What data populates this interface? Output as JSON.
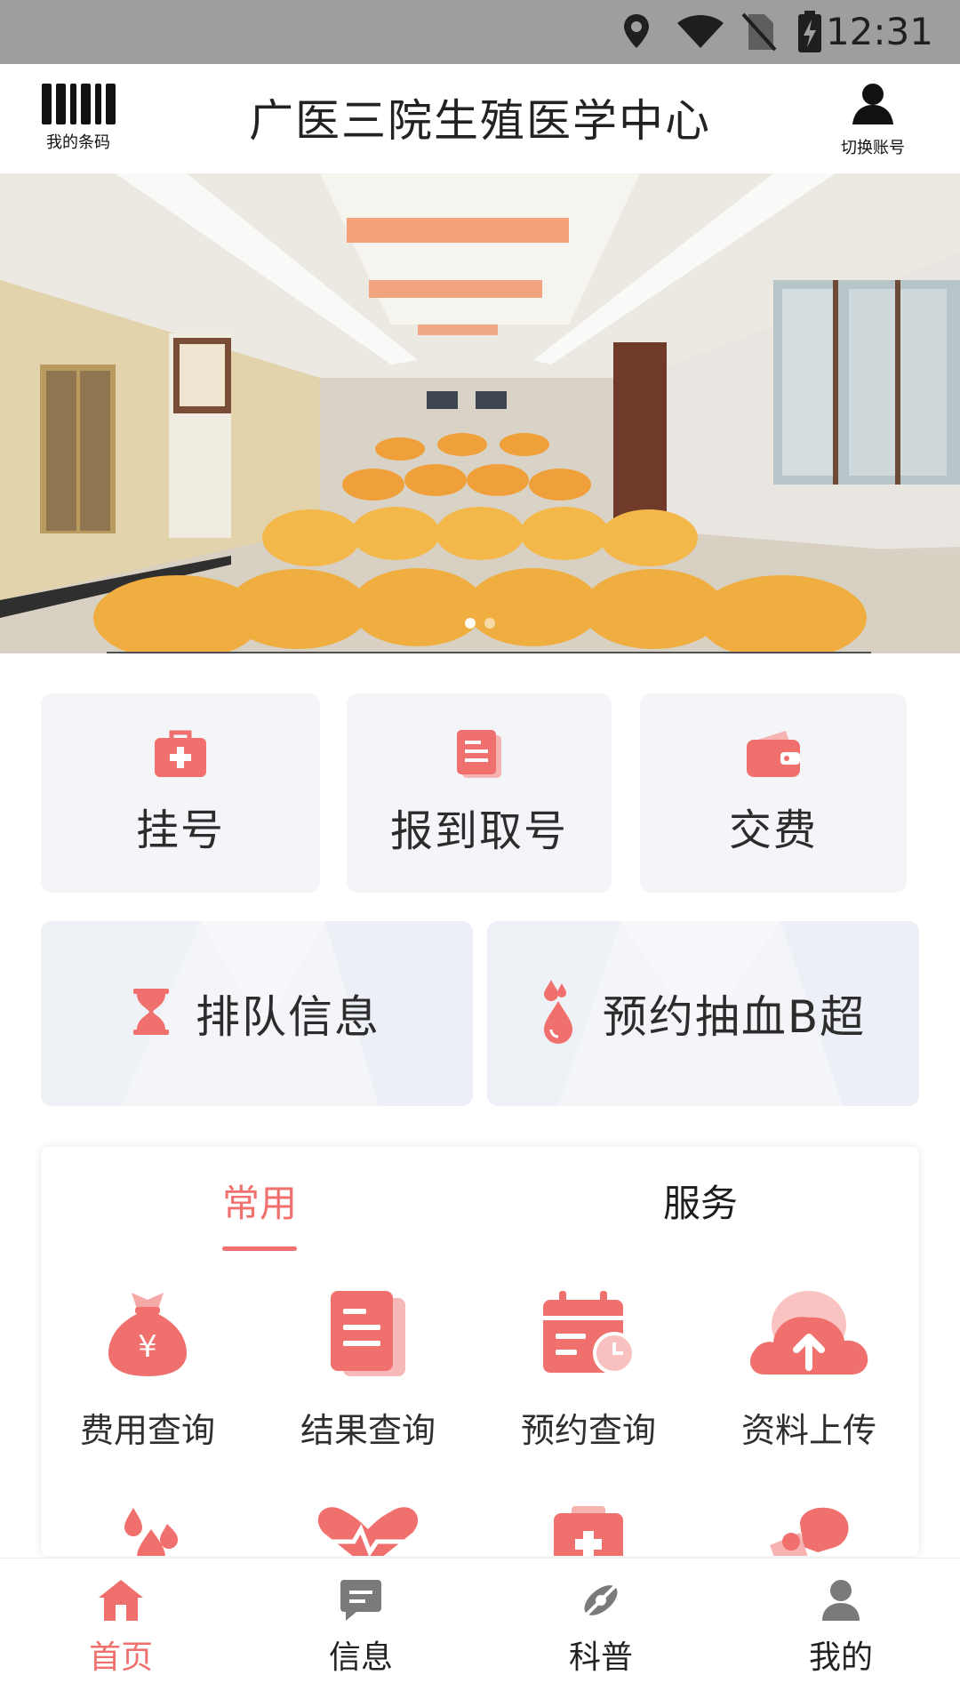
{
  "status_bar": {
    "time": "12:31",
    "icons": [
      "location-icon",
      "wifi-icon",
      "no-sim-icon",
      "battery-charging-icon"
    ]
  },
  "header": {
    "barcode_label": "我的条码",
    "title": "广医三院生殖医学中心",
    "switch_account_label": "切换账号"
  },
  "banner": {
    "slide_count": 2,
    "active_slide": 1
  },
  "quick_actions": [
    {
      "label": "挂号",
      "icon": "medical-kit-icon"
    },
    {
      "label": "报到取号",
      "icon": "document-icon"
    },
    {
      "label": "交费",
      "icon": "wallet-icon"
    }
  ],
  "wide_actions": [
    {
      "label": "排队信息",
      "icon": "hourglass-icon"
    },
    {
      "label": "预约抽血B超",
      "icon": "blood-drop-icon"
    }
  ],
  "tabs": [
    {
      "label": "常用",
      "active": true
    },
    {
      "label": "服务",
      "active": false
    }
  ],
  "common_items": [
    {
      "label": "费用查询",
      "icon": "money-bag-icon"
    },
    {
      "label": "结果查询",
      "icon": "report-icon"
    },
    {
      "label": "预约查询",
      "icon": "calendar-clock-icon"
    },
    {
      "label": "资料上传",
      "icon": "cloud-upload-icon"
    }
  ],
  "common_items_row2_icons": [
    "blood-drops-icon",
    "heart-pulse-icon",
    "clipboard-medical-icon",
    "boxing-glove-icon"
  ],
  "colors": {
    "accent": "#f0706e",
    "card_bg": "#f3f5f9",
    "status_bar": "#9e9e9e"
  },
  "bottom_nav": [
    {
      "label": "首页",
      "icon": "home-icon",
      "active": true
    },
    {
      "label": "信息",
      "icon": "message-icon",
      "active": false
    },
    {
      "label": "科普",
      "icon": "satellite-icon",
      "active": false
    },
    {
      "label": "我的",
      "icon": "person-icon",
      "active": false
    }
  ]
}
